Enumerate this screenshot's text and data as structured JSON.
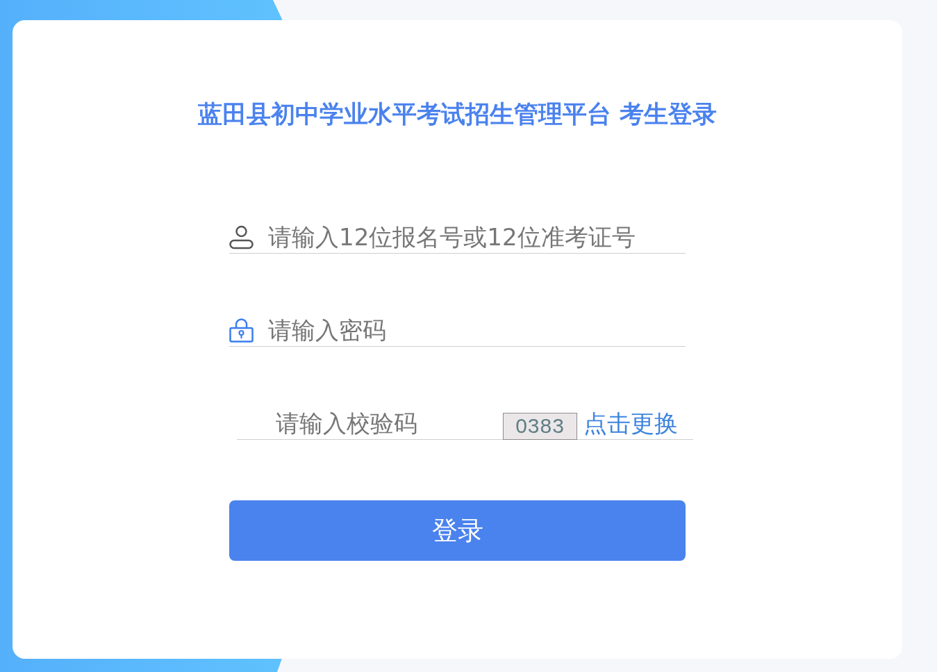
{
  "title": "蓝田县初中学业水平考试招生管理平台 考生登录",
  "fields": [
    {
      "kind": "user",
      "placeholder": "请输入12位报名号或12位准考证号"
    },
    {
      "kind": "password",
      "placeholder": "请输入密码"
    },
    {
      "kind": "captcha",
      "placeholder": "请输入校验码",
      "captcha_code": "0383",
      "refresh_link": "点击更换"
    }
  ],
  "login_button": "登录"
}
